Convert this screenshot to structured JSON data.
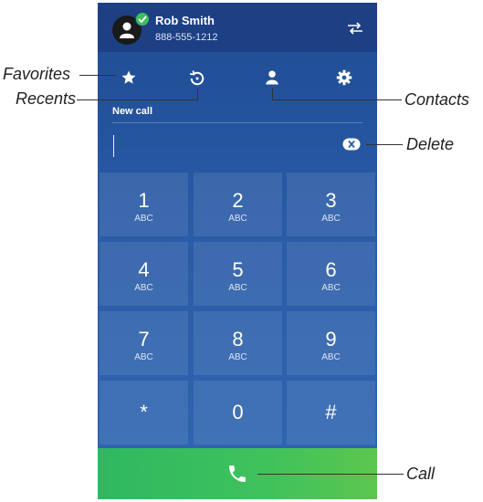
{
  "header": {
    "user_name": "Rob Smith",
    "user_number": "888-555-1212",
    "presence_status": "available",
    "presence_color": "#3cbf5a"
  },
  "tabs": [
    {
      "id": "favorites",
      "icon": "star-icon"
    },
    {
      "id": "recents",
      "icon": "history-icon"
    },
    {
      "id": "contacts",
      "icon": "person-icon"
    },
    {
      "id": "settings",
      "icon": "gear-icon"
    }
  ],
  "dialer": {
    "section_label": "New call",
    "input_value": "",
    "input_placeholder": "",
    "keys": [
      {
        "digit": "1",
        "letters": "ABC"
      },
      {
        "digit": "2",
        "letters": "ABC"
      },
      {
        "digit": "3",
        "letters": "ABC"
      },
      {
        "digit": "4",
        "letters": "ABC"
      },
      {
        "digit": "5",
        "letters": "ABC"
      },
      {
        "digit": "6",
        "letters": "ABC"
      },
      {
        "digit": "7",
        "letters": "ABC"
      },
      {
        "digit": "8",
        "letters": "ABC"
      },
      {
        "digit": "9",
        "letters": "ABC"
      },
      {
        "digit": "*",
        "letters": ""
      },
      {
        "digit": "0",
        "letters": ""
      },
      {
        "digit": "#",
        "letters": ""
      }
    ]
  },
  "callouts": {
    "favorites": "Favorites",
    "recents": "Recents",
    "contacts": "Contacts",
    "delete": "Delete",
    "call": "Call"
  },
  "colors": {
    "header_bg": "#1d3f84",
    "panel_bg": "#2a5ba7",
    "call_green": "#3ec25c"
  }
}
